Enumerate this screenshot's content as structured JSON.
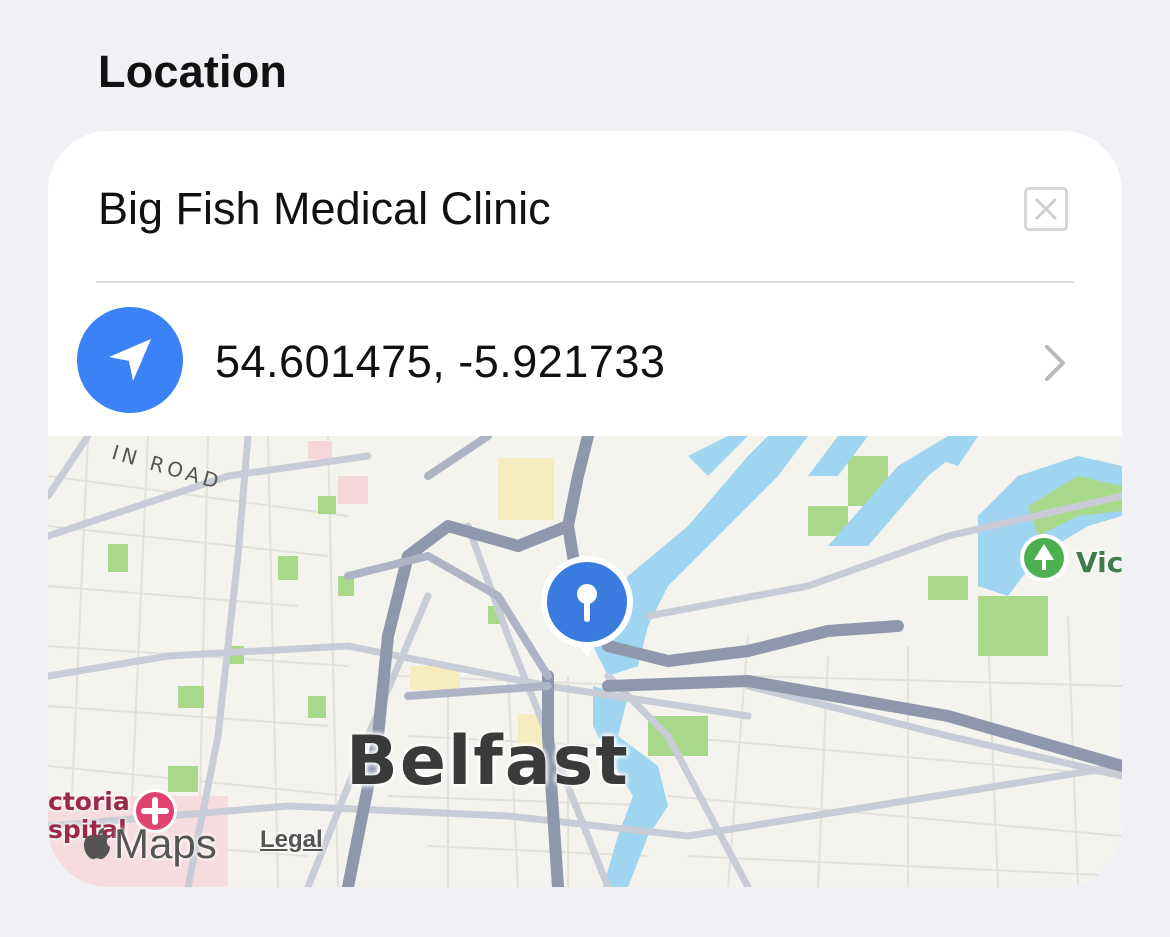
{
  "section": {
    "title": "Location"
  },
  "location": {
    "name": "Big Fish Medical Clinic",
    "clear_icon": "clear-icon",
    "coordinates": "54.601475, -5.921733",
    "location_icon": "location-arrow-icon",
    "chevron_icon": "chevron-right-icon"
  },
  "map": {
    "city_label": "Belfast",
    "road_label": "IN ROAD",
    "park_label": "Vict",
    "hospital_label_line1": "ctoria",
    "hospital_label_line2": "spital",
    "brand_label": "Maps",
    "legal_link": "Legal",
    "pin_icon": "map-pin-icon",
    "park_icon": "tree-icon",
    "hospital_icon": "hospital-cross-icon"
  },
  "colors": {
    "accent": "#3b82f6",
    "water": "#9fd5f0",
    "park": "#a8d98a",
    "road_major": "#8f97ad",
    "background": "#f0f0f5"
  }
}
